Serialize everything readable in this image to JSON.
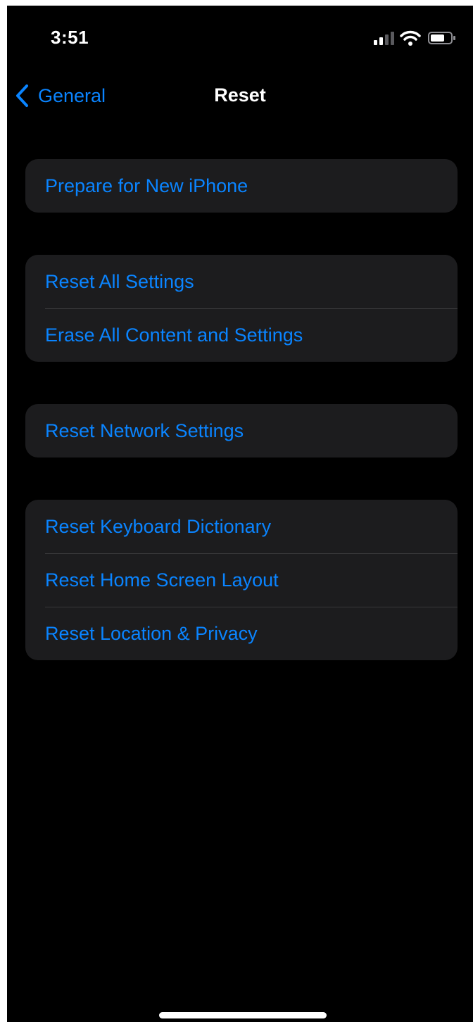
{
  "status_bar": {
    "time": "3:51",
    "icons": [
      "cellular-signal-icon",
      "wifi-icon",
      "battery-icon"
    ]
  },
  "nav": {
    "back_label": "General",
    "title": "Reset",
    "back_icon": "chevron-left-icon"
  },
  "groups": [
    {
      "items": [
        {
          "label": "Prepare for New iPhone"
        }
      ]
    },
    {
      "items": [
        {
          "label": "Reset All Settings"
        },
        {
          "label": "Erase All Content and Settings"
        }
      ]
    },
    {
      "items": [
        {
          "label": "Reset Network Settings"
        }
      ]
    },
    {
      "items": [
        {
          "label": "Reset Keyboard Dictionary"
        },
        {
          "label": "Reset Home Screen Layout"
        },
        {
          "label": "Reset Location & Privacy"
        }
      ]
    }
  ],
  "colors": {
    "accent": "#0a84ff",
    "background": "#000000",
    "cell_background": "#1c1c1e",
    "separator": "#38383a",
    "text_primary": "#ffffff"
  }
}
